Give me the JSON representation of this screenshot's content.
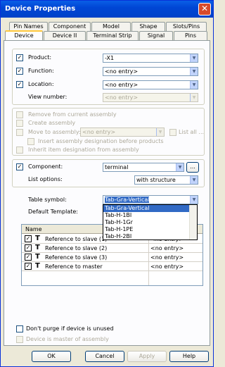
{
  "window": {
    "title": "Device Properties",
    "close": "✕"
  },
  "tabs_row1": [
    "Pin Names",
    "Component",
    "Model",
    "Shape",
    "Slots/Pins"
  ],
  "tabs_row2": [
    "Device",
    "Device II",
    "Terminal Strip",
    "Signal",
    "Pins"
  ],
  "fields": {
    "product_label": "Product:",
    "product_value": "-X1",
    "function_label": "Function:",
    "function_value": "<no entry>",
    "location_label": "Location:",
    "location_value": "<no entry>",
    "view_label": "View number:",
    "view_value": "<no entry>"
  },
  "assembly": {
    "remove": "Remove from current assembly",
    "create": "Create assembly",
    "move": "Move to assembly:",
    "move_value": "<no entry>",
    "list_all": "List all ...",
    "insert": "Insert assembly designation before products",
    "inherit": "Inherit item designation from assembly"
  },
  "component": {
    "label": "Component:",
    "value": "terminal",
    "browse": "...",
    "list_options_label": "List options:",
    "list_options_value": "with structure"
  },
  "table_symbol": {
    "label": "Table symbol:",
    "value": "Tab-Gra-Vertical",
    "default_template_label": "Default Template:",
    "options": [
      "Tab-Gra-Vertical",
      "Tab-H-1BI",
      "Tab-H-1Gr",
      "Tab-H-1PE",
      "Tab-H-2BI"
    ]
  },
  "table": {
    "header_name": "Name",
    "rows": [
      {
        "name": "Reference to slave (1)",
        "value": "<no entry>"
      },
      {
        "name": "Reference to slave (2)",
        "value": "<no entry>"
      },
      {
        "name": "Reference to slave (3)",
        "value": "<no entry>"
      },
      {
        "name": "Reference to master",
        "value": "<no entry>"
      }
    ]
  },
  "bottom": {
    "no_purge": "Don't purge if device is unused",
    "master": "Device is master of assembly"
  },
  "buttons": {
    "ok": "OK",
    "cancel": "Cancel",
    "apply": "Apply",
    "help": "Help"
  },
  "icons": {
    "check": "✓",
    "dropdown": "▼",
    "t": "T"
  }
}
